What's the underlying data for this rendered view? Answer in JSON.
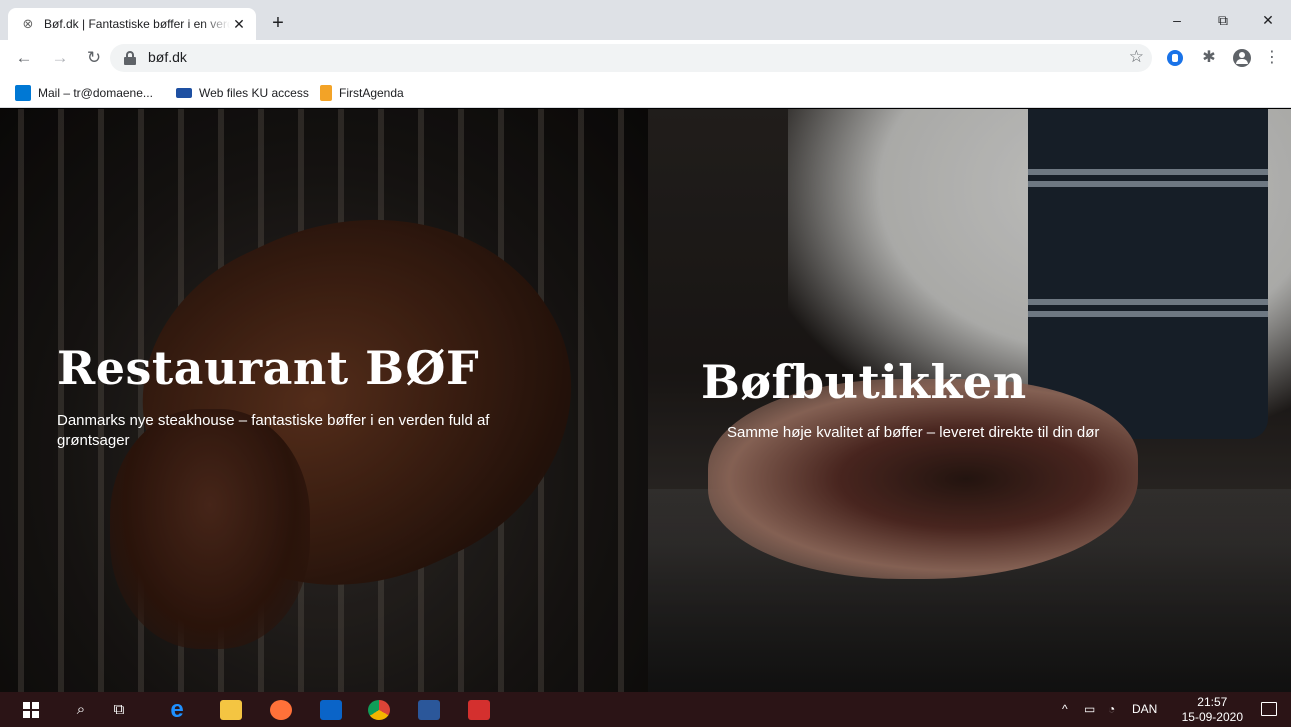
{
  "browser": {
    "tab": {
      "title": "Bøf.dk | Fantastiske bøffer i en verden fuld af grøntsager",
      "favicon": "steak-favicon-icon"
    },
    "new_tab_symbol": "+",
    "url": "bøf.dk",
    "window_controls": {
      "minimize": "–",
      "maximize": "⧉",
      "close": "✕"
    },
    "bookmarks": [
      {
        "label": "Mail – tr@domaene...",
        "icon": "outlook-icon",
        "color": "#0078d4"
      },
      {
        "label": "Web files KU access",
        "icon": "ku-icon",
        "color": "#1e50a2"
      },
      {
        "label": "FirstAgenda",
        "icon": "firstagenda-icon",
        "color": "#f3a327"
      }
    ]
  },
  "hero": {
    "left": {
      "title": "Restaurant BØF",
      "subtitle": "Danmarks nye steakhouse – fantastiske bøffer i en verden fuld af grøntsager"
    },
    "right": {
      "title": "Bøfbutikken",
      "subtitle": "Samme høje kvalitet af bøffer – leveret direkte til din dør"
    }
  },
  "taskbar": {
    "apps": [
      "windows-start",
      "search",
      "task-view",
      "internet-explorer",
      "file-explorer",
      "firefox",
      "outlook",
      "chrome",
      "word",
      "acrobat"
    ],
    "tray": {
      "language": "DAN",
      "time": "21:57",
      "date": "15-09-2020"
    }
  },
  "colors": {
    "taskbar": "#2b1416",
    "tabstrip": "#dee1e6",
    "accent_blue": "#1a73e8"
  }
}
